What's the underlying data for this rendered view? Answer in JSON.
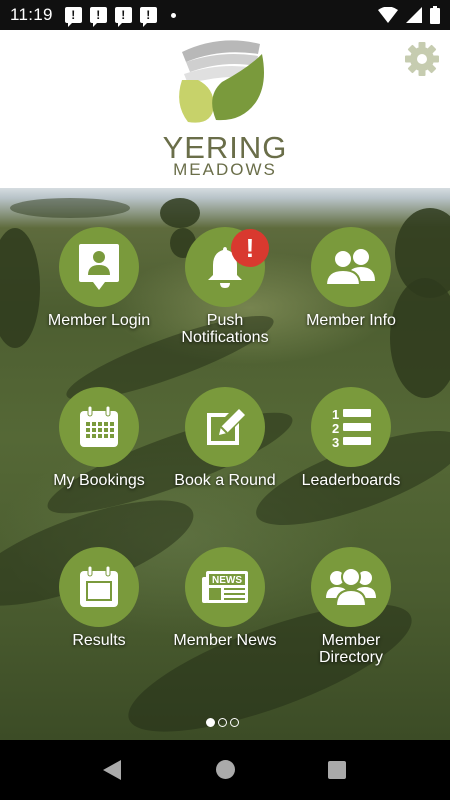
{
  "status_bar": {
    "time": "11:19",
    "notification_icons": [
      "!",
      "!",
      "!",
      "!"
    ],
    "icons": [
      "wifi-icon",
      "signal-icon",
      "battery-icon"
    ]
  },
  "header": {
    "logo_title": "YERING",
    "logo_subtitle": "MEADOWS",
    "settings_icon": "gear-icon"
  },
  "tiles": [
    {
      "label": "Member Login",
      "icon": "member-login-icon"
    },
    {
      "label": "Push\nNotifications",
      "icon": "bell-icon",
      "badge": "!"
    },
    {
      "label": "Member Info",
      "icon": "member-info-icon"
    },
    {
      "label": "My Bookings",
      "icon": "calendar-grid-icon"
    },
    {
      "label": "Book a Round",
      "icon": "edit-icon"
    },
    {
      "label": "Leaderboards",
      "icon": "numbered-list-icon"
    },
    {
      "label": "Results",
      "icon": "calendar-icon"
    },
    {
      "label": "Member News",
      "icon": "news-icon",
      "icon_text": "NEWS"
    },
    {
      "label": "Member\nDirectory",
      "icon": "group-icon"
    }
  ],
  "pager": {
    "pages": 3,
    "current": 1
  },
  "colors": {
    "tile_green": "#7a9a3c",
    "badge_red": "#d9392f",
    "logo_text": "#6a6e49",
    "logo_light_green": "#c7d26a",
    "logo_dark_green": "#7a9a3c"
  }
}
